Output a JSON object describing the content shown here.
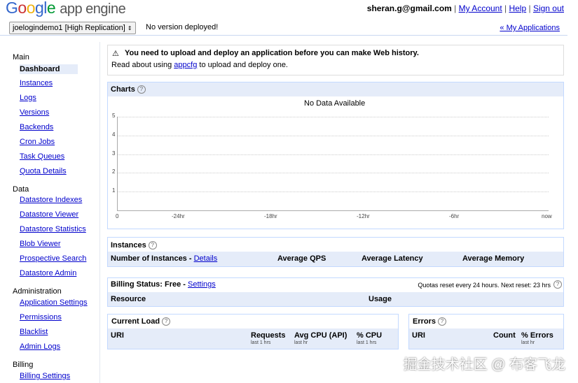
{
  "header": {
    "logo_google": "Google",
    "logo_product": "app engine",
    "user_email": "sheran.g@gmail.com",
    "links": [
      "My Account",
      "Help",
      "Sign out"
    ]
  },
  "appbar": {
    "selected_app": "joelogindemo1 [High Replication]",
    "status": "No version deployed!",
    "my_applications": "« My Applications"
  },
  "sidebar": {
    "sections": [
      {
        "label": "Main",
        "items": [
          "Dashboard",
          "Instances",
          "Logs",
          "Versions",
          "Backends",
          "Cron Jobs",
          "Task Queues",
          "Quota Details"
        ]
      },
      {
        "label": "Data",
        "items": [
          "Datastore Indexes",
          "Datastore Viewer",
          "Datastore Statistics",
          "Blob Viewer",
          "Prospective Search",
          "Datastore Admin"
        ]
      },
      {
        "label": "Administration",
        "items": [
          "Application Settings",
          "Permissions",
          "Blacklist",
          "Admin Logs"
        ]
      },
      {
        "label": "Billing",
        "items": [
          "Billing Settings"
        ]
      }
    ],
    "selected": "Dashboard"
  },
  "warning": {
    "icon": "warning-icon",
    "title": "You need to upload and deploy an application before you can make Web history.",
    "text_before": "Read about using ",
    "link": "appcfg",
    "text_after": " to upload and deploy one."
  },
  "charts": {
    "title": "Charts",
    "no_data": "No Data Available"
  },
  "chart_data": {
    "type": "line",
    "title": "No Data Available",
    "y_ticks": [
      "5",
      "4",
      "3",
      "2",
      "1",
      "0"
    ],
    "x_ticks": [
      "-24hr",
      "-18hr",
      "-12hr",
      "-6hr",
      "now"
    ],
    "ylim": [
      0,
      5
    ],
    "series": [],
    "grid": true
  },
  "instances": {
    "title": "Instances",
    "col_number": "Number of Instances - ",
    "details_link": "Details",
    "col_qps": "Average QPS",
    "col_latency": "Average Latency",
    "col_memory": "Average Memory"
  },
  "billing": {
    "label": "Billing Status: Free - ",
    "settings_link": "Settings",
    "quota_note": "Quotas reset every 24 hours. Next reset: 23 hrs",
    "col_resource": "Resource",
    "col_usage": "Usage"
  },
  "current_load": {
    "title": "Current Load",
    "col_uri": "URI",
    "col_requests": "Requests",
    "col_requests_sub": "last 1 hrs",
    "col_cpu_api": "Avg CPU (API)",
    "col_cpu_api_sub": "last hr",
    "col_cpu": "% CPU",
    "col_cpu_sub": "last 1 hrs"
  },
  "errors": {
    "title": "Errors",
    "col_uri": "URI",
    "col_count": "Count",
    "col_errors": "% Errors",
    "col_errors_sub": "last hr"
  },
  "watermark": "掘金技术社区 @ 布客飞龙"
}
